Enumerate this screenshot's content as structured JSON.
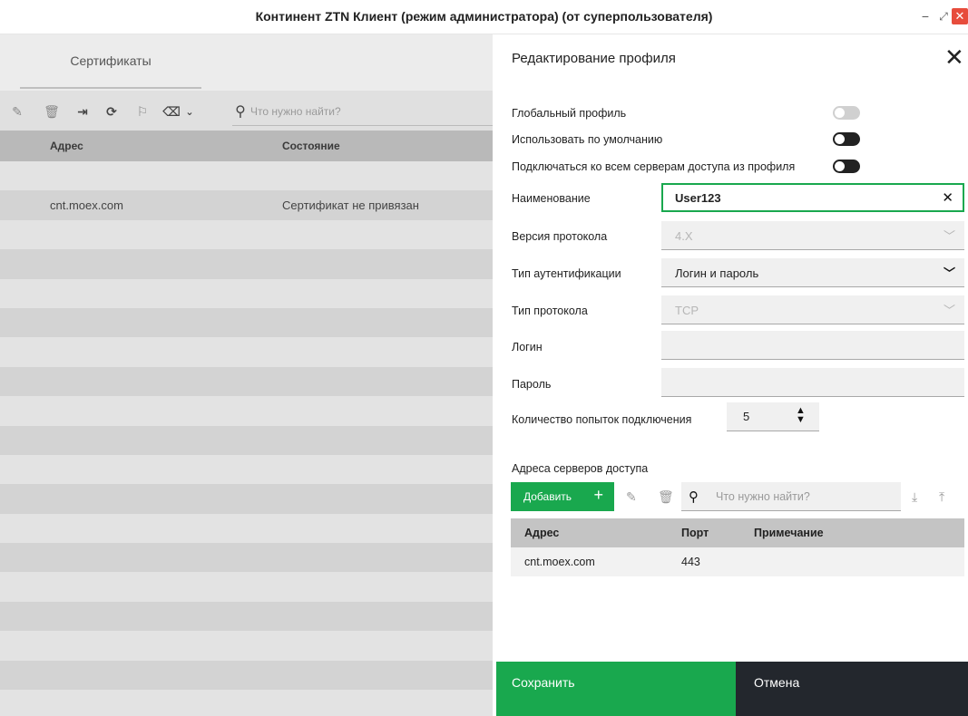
{
  "window": {
    "title": "Континент ZTN Клиент (режим администратора) (от суперпользователя)",
    "min_icon": "−",
    "max_icon": "⤢",
    "close_icon": "✕"
  },
  "left": {
    "tab_certificates": "Сертификаты",
    "search_placeholder": "Что нужно найти?",
    "columns": [
      "Адрес",
      "Состояние"
    ],
    "rows": [
      {
        "address": "",
        "state": ""
      },
      {
        "address": "cnt.moex.com",
        "state": "Сертификат не привязан"
      },
      {
        "address": "",
        "state": ""
      }
    ]
  },
  "dialog": {
    "title": "Редактирование профиля",
    "global_profile": {
      "label": "Глобальный профиль",
      "on": false
    },
    "use_default": {
      "label": "Использовать по умолчанию",
      "on": true
    },
    "connect_all": {
      "label": "Подключаться ко всем серверам доступа из профиля",
      "on": true
    },
    "name": {
      "label": "Наименование",
      "value": "User123"
    },
    "protocol_version": {
      "label": "Версия протокола",
      "value": "4.X"
    },
    "auth_type": {
      "label": "Тип аутентификации",
      "value": "Логин и пароль"
    },
    "protocol_type": {
      "label": "Тип протокола",
      "value": "TCP"
    },
    "login": {
      "label": "Логин",
      "value": ""
    },
    "password": {
      "label": "Пароль",
      "value": ""
    },
    "attempts": {
      "label": "Количество попыток подключения",
      "value": "5"
    },
    "servers": {
      "section_title": "Адреса серверов доступа",
      "add_label": "Добавить",
      "search_placeholder": "Что нужно найти?",
      "columns": {
        "address": "Адрес",
        "port": "Порт",
        "note": "Примечание"
      },
      "rows": [
        {
          "address": "cnt.moex.com",
          "port": "443",
          "note": ""
        }
      ]
    },
    "save_label": "Сохранить",
    "cancel_label": "Отмена"
  },
  "colors": {
    "accent": "#19a84e",
    "dark": "#23272d",
    "close_red": "#e74c3c"
  }
}
